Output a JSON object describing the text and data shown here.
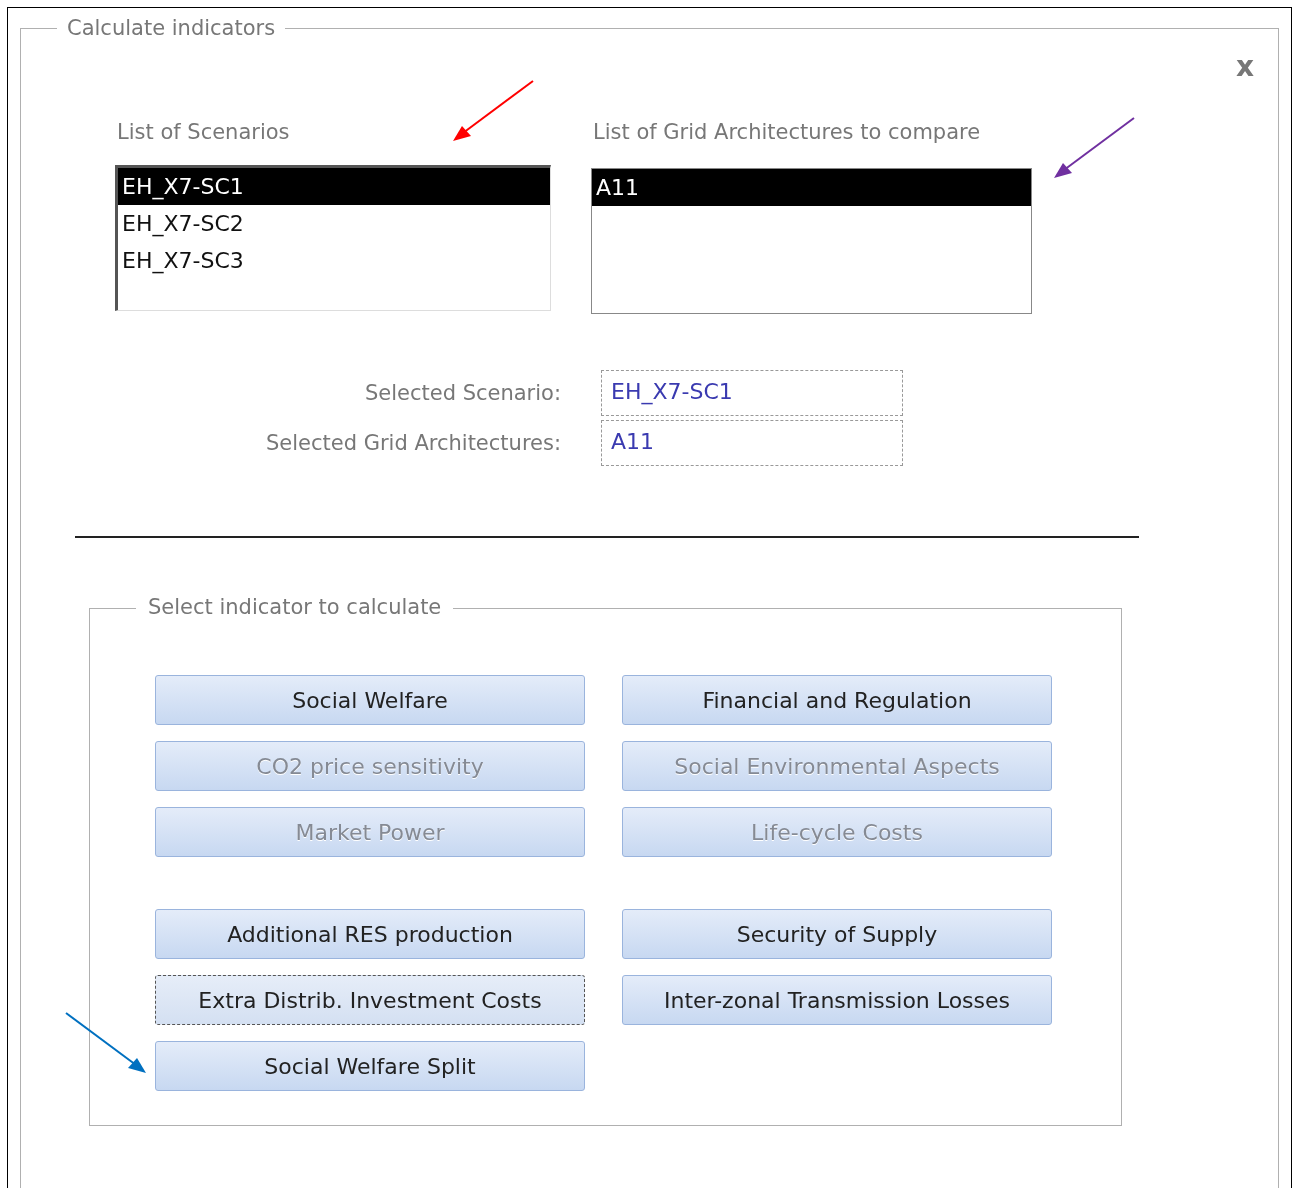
{
  "window": {
    "title": "Calculate indicators",
    "close": "x"
  },
  "scenarios": {
    "label": "List of Scenarios",
    "items": [
      {
        "label": "EH_X7-SC1",
        "selected": true
      },
      {
        "label": "EH_X7-SC2",
        "selected": false
      },
      {
        "label": "EH_X7-SC3",
        "selected": false
      }
    ]
  },
  "architectures": {
    "label": "List of Grid Architectures to compare",
    "items": [
      {
        "label": "A11",
        "selected": true
      }
    ]
  },
  "selection": [
    {
      "label": "Selected Scenario:",
      "value": "EH_X7-SC1"
    },
    {
      "label": "Selected Grid Architectures:",
      "value": "A11"
    }
  ],
  "indicators": {
    "title": "Select indicator to calculate",
    "groups": [
      {
        "columns": [
          [
            {
              "label": "Social Welfare",
              "disabled": false,
              "focused": false
            },
            {
              "label": "CO2 price sensitivity",
              "disabled": true,
              "focused": false
            },
            {
              "label": "Market Power",
              "disabled": true,
              "focused": false
            }
          ],
          [
            {
              "label": "Financial and Regulation",
              "disabled": false,
              "focused": false
            },
            {
              "label": "Social Environmental Aspects",
              "disabled": true,
              "focused": false
            },
            {
              "label": "Life-cycle Costs",
              "disabled": true,
              "focused": false
            }
          ]
        ]
      },
      {
        "columns": [
          [
            {
              "label": "Additional RES production",
              "disabled": false,
              "focused": false
            },
            {
              "label": "Extra Distrib. Investment Costs",
              "disabled": false,
              "focused": true
            },
            {
              "label": "Social Welfare Split",
              "disabled": false,
              "focused": false
            }
          ],
          [
            {
              "label": "Security of Supply",
              "disabled": false,
              "focused": false
            },
            {
              "label": "Inter-zonal Transmission Losses",
              "disabled": false,
              "focused": false
            }
          ]
        ]
      }
    ]
  },
  "annotations": [
    {
      "color": "#ff0000"
    },
    {
      "color": "#7030a0"
    },
    {
      "color": "#0070c0"
    }
  ]
}
